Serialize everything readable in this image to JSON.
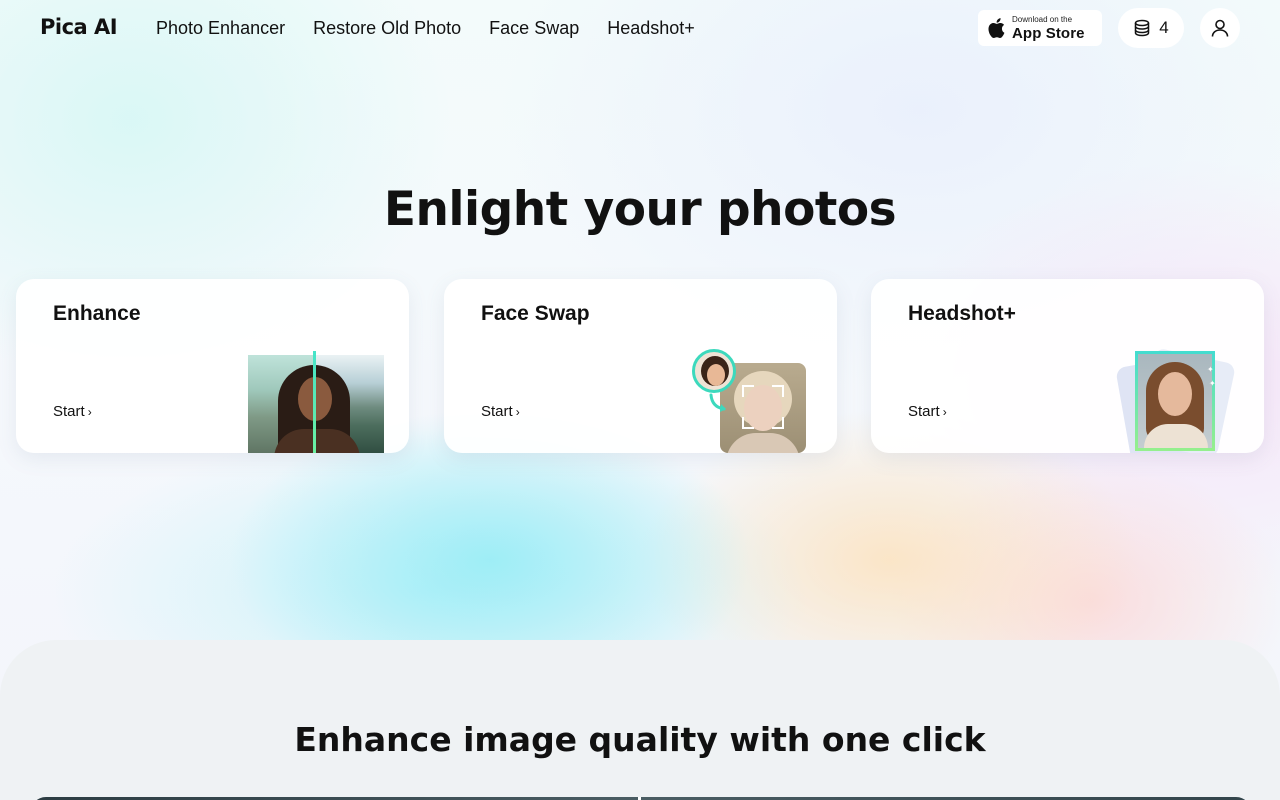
{
  "header": {
    "logo": "Pica AI",
    "nav": [
      {
        "label": "Photo Enhancer"
      },
      {
        "label": "Restore Old Photo"
      },
      {
        "label": "Face Swap"
      },
      {
        "label": "Headshot+"
      }
    ],
    "appstore": {
      "small": "Download on the",
      "big": "App Store"
    },
    "credits": "4"
  },
  "hero": {
    "title": "Enlight your photos",
    "cards": [
      {
        "title": "Enhance",
        "cta": "Start"
      },
      {
        "title": "Face Swap",
        "cta": "Start"
      },
      {
        "title": "Headshot+",
        "cta": "Start"
      }
    ]
  },
  "section2": {
    "title": "Enhance image quality with one click"
  },
  "colors": {
    "accent_teal": "#3cd9bd",
    "accent_green": "#95ef8d",
    "text": "#111111"
  },
  "icons": {
    "logo": "pica-logo",
    "apple": "apple-icon",
    "credits": "coins-stack-icon",
    "user": "user-icon",
    "chevron": "chevron-right-icon"
  }
}
